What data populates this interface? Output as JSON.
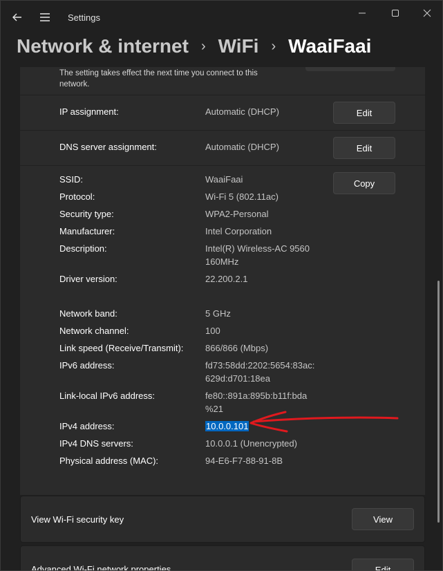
{
  "app": {
    "title": "Settings"
  },
  "breadcrumb": [
    "Network & internet",
    "WiFi",
    "WaaiFaai"
  ],
  "note": "The setting takes effect the next time you connect to this network.",
  "ip_assignment": {
    "label": "IP assignment:",
    "value": "Automatic (DHCP)",
    "button": "Edit"
  },
  "dns_assignment": {
    "label": "DNS server assignment:",
    "value": "Automatic (DHCP)",
    "button": "Edit"
  },
  "copy_button": "Copy",
  "properties": [
    {
      "label": "SSID:",
      "value": "WaaiFaai"
    },
    {
      "label": "Protocol:",
      "value": "Wi-Fi 5 (802.11ac)"
    },
    {
      "label": "Security type:",
      "value": "WPA2-Personal"
    },
    {
      "label": "Manufacturer:",
      "value": "Intel Corporation"
    },
    {
      "label": "Description:",
      "value": "Intel(R) Wireless-AC 9560",
      "value2": "160MHz"
    },
    {
      "label": "Driver version:",
      "value": "22.200.2.1"
    },
    {
      "label": "Network band:",
      "value": "5 GHz"
    },
    {
      "label": "Network channel:",
      "value": "100"
    },
    {
      "label": "Link speed (Receive/Transmit):",
      "value": "866/866 (Mbps)"
    },
    {
      "label": "IPv6 address:",
      "value": "fd73:58dd:2202:5654:83ac:",
      "value2": "629d:d701:18ea"
    },
    {
      "label": "Link-local IPv6 address:",
      "value": "fe80::891a:895b:b11f:bda",
      "value2": "%21"
    },
    {
      "label": "IPv4 address:",
      "value": "10.0.0.101"
    },
    {
      "label": "IPv4 DNS servers:",
      "value": "10.0.0.1 (Unencrypted)"
    },
    {
      "label": "Physical address (MAC):",
      "value": "94-E6-F7-88-91-8B"
    }
  ],
  "security_key": {
    "label": "View Wi-Fi security key",
    "button": "View"
  },
  "advanced": {
    "label": "Advanced Wi-Fi network properties",
    "button": "Edit"
  },
  "colors": {
    "highlight": "#0067c0",
    "annotation": "#e0191e"
  }
}
